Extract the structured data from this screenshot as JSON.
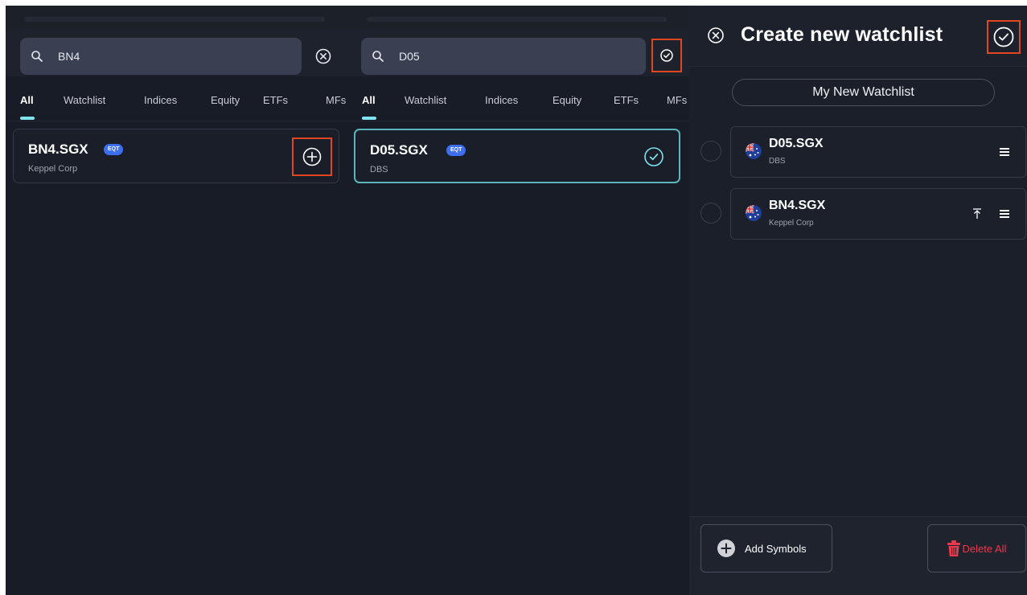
{
  "panel_search": {
    "query": "BN4",
    "tabs": [
      "All",
      "Watchlist",
      "Indices",
      "Equity",
      "ETFs",
      "MFs"
    ],
    "result": {
      "symbol": "BN4.SGX",
      "badge": "EQT",
      "name": "Keppel Corp"
    }
  },
  "panel_selected": {
    "query": "D05",
    "tabs": [
      "All",
      "Watchlist",
      "Indices",
      "Equity",
      "ETFs",
      "MFs"
    ],
    "result": {
      "symbol": "D05.SGX",
      "badge": "EQT",
      "name": "DBS"
    }
  },
  "panel_create": {
    "title": "Create new watchlist",
    "watchlist_name": "My New Watchlist",
    "items": [
      {
        "symbol": "D05.SGX",
        "name": "DBS"
      },
      {
        "symbol": "BN4.SGX",
        "name": "Keppel Corp"
      }
    ],
    "add_symbols_label": "Add Symbols",
    "delete_all_label": "Delete All"
  },
  "colors": {
    "accent_cyan": "#7fe3f0",
    "highlight_red": "#e0461f",
    "badge_blue": "#3d6ef0",
    "danger": "#e8394d"
  },
  "icons": [
    "search-icon",
    "close-icon",
    "check-circle-icon",
    "plus-circle-icon",
    "flag-icon",
    "drag-handle-icon",
    "pin-to-top-icon",
    "trash-icon"
  ]
}
